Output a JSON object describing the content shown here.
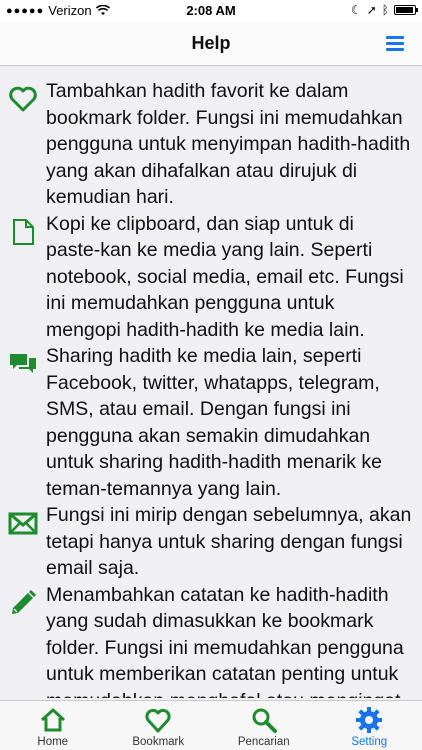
{
  "status_bar": {
    "carrier": "Verizon",
    "time": "2:08 AM",
    "battery_level": 0.95
  },
  "header": {
    "title": "Help"
  },
  "items": [
    {
      "icon": "heart-icon",
      "text": "Tambahkan hadith favorit ke dalam bookmark folder. Fungsi ini memudahkan pengguna untuk menyimpan hadith-hadith yang akan dihafalkan atau dirujuk di kemudian hari."
    },
    {
      "icon": "document-icon",
      "text": "Kopi ke clipboard, dan siap untuk di paste-kan ke media yang lain. Seperti notebook, social media, email etc. Fungsi ini memudahkan pengguna untuk mengopi hadith-hadith ke media lain."
    },
    {
      "icon": "chat-icon",
      "text": "Sharing hadith ke media lain, seperti Facebook, twitter, whatapps, telegram, SMS, atau email. Dengan fungsi ini pengguna akan semakin dimudahkan untuk sharing hadith-hadith menarik ke teman-temannya yang lain."
    },
    {
      "icon": "envelope-icon",
      "text": "Fungsi ini mirip dengan sebelumnya, akan tetapi hanya untuk sharing dengan fungsi email saja."
    },
    {
      "icon": "pencil-icon",
      "text": "Menambahkan catatan ke hadith-hadith yang sudah dimasukkan ke bookmark folder. Fungsi ini memudahkan pengguna untuk memberikan catatan penting untuk memudahkan menghafal atau mengingat"
    }
  ],
  "tabs": [
    {
      "label": "Home",
      "icon": "home-icon"
    },
    {
      "label": "Bookmark",
      "icon": "heart-icon"
    },
    {
      "label": "Pencarian",
      "icon": "search-icon"
    },
    {
      "label": "Setting",
      "icon": "gear-icon",
      "active": true
    }
  ],
  "colors": {
    "icon_green": "#1e8c2e",
    "accent_blue": "#1a73e8"
  }
}
